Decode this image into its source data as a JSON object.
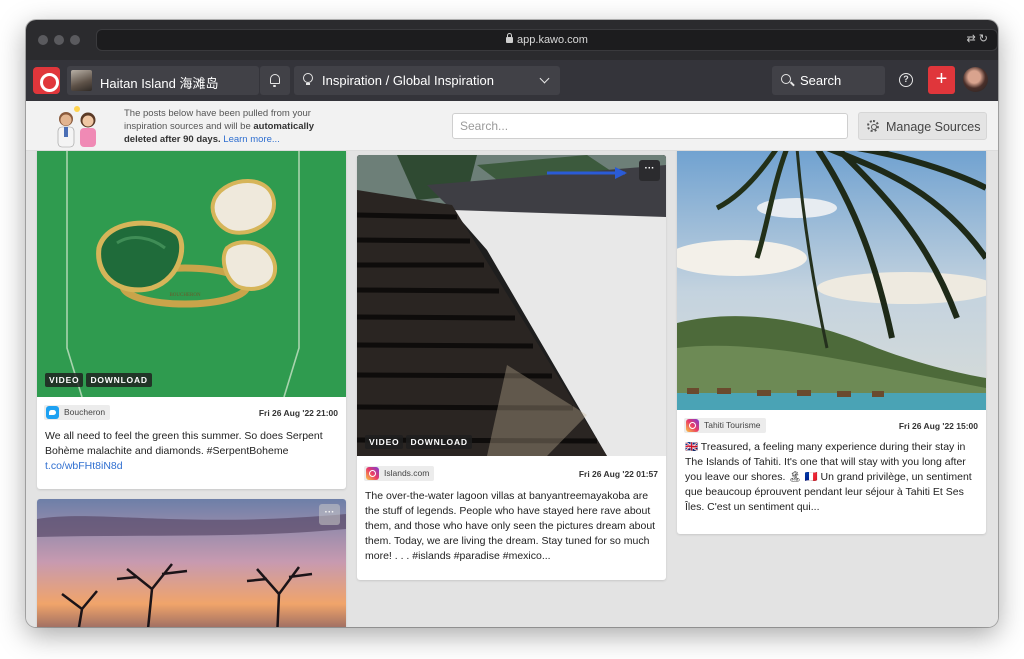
{
  "browser": {
    "url": "app.kawo.com"
  },
  "header": {
    "workspace": "Haitan Island 海滩岛",
    "inspiration": "Inspiration / Global Inspiration",
    "search_label": "Search",
    "add_label": "+",
    "help_label": "?"
  },
  "infobar": {
    "text_before": "The posts below have been pulled from your inspiration sources and will be ",
    "text_bold": "automatically deleted after 90 days.",
    "link": "Learn more...",
    "search_placeholder": "Search...",
    "manage_label": "Manage Sources"
  },
  "posts": [
    {
      "source": "Boucheron",
      "platform": "twitter-icon",
      "date": "Fri 26 Aug '22 21:00",
      "badges": [
        "VIDEO",
        "DOWNLOAD"
      ],
      "text": "We all need to feel the green this summer. So does Serpent Bohème malachite and diamonds. #SerpentBoheme",
      "link": "t.co/wbFHt8iN8d",
      "brand_mark": "BOUCHERON"
    },
    {
      "source": "Islands.com",
      "platform": "instagram-icon",
      "date": "Fri 26 Aug '22 01:57",
      "badges": [
        "VIDEO",
        "DOWNLOAD"
      ],
      "text": "The over-the-water lagoon villas at banyantreemayakoba are the stuff of legends. People who have stayed here rave about them, and those who have only seen the pictures dream about them. Today, we are living the dream. Stay tuned for so much more! . . . #islands #paradise #mexico..."
    },
    {
      "source": "Tahiti Tourisme",
      "platform": "instagram-icon",
      "date": "Fri 26 Aug '22 15:00",
      "text": "🇬🇧 Treasured, a feeling many experience during their stay in The Islands of Tahiti. It's one that will stay with you long after you leave our shores. 🏝 🇫🇷 Un grand privilège, un sentiment que beaucoup éprouvent pendant leur séjour à Tahiti Et Ses Îles. C'est un sentiment qui..."
    }
  ],
  "more_label": "···",
  "colors": {
    "brand_red": "#e0363b",
    "arrow_blue": "#2a5bd7",
    "link_blue": "#2f6fd0"
  }
}
